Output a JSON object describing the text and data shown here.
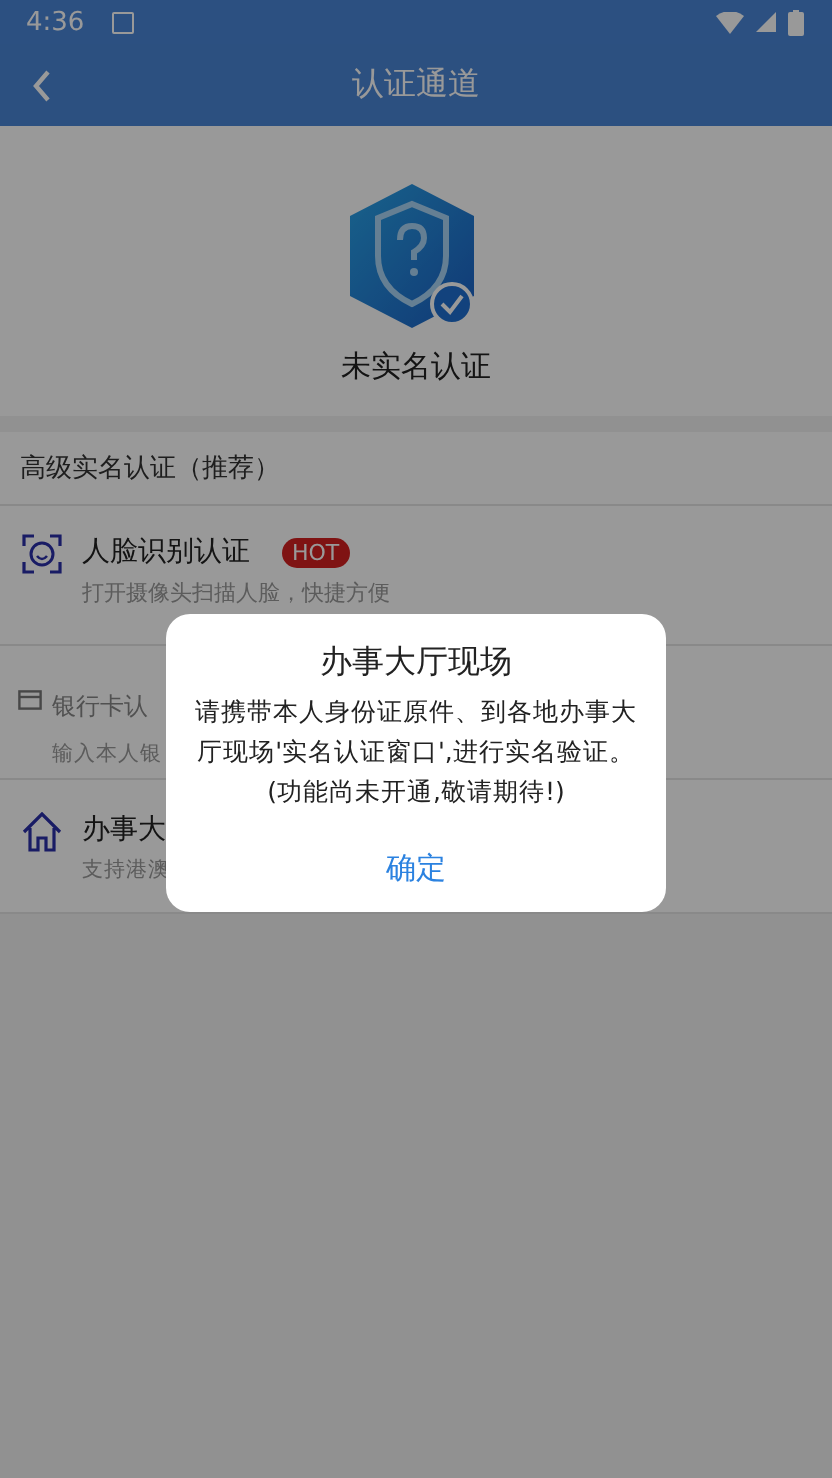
{
  "status_bar": {
    "time": "4:36"
  },
  "app_bar": {
    "title": "认证通道"
  },
  "profile": {
    "status": "未实名认证"
  },
  "section": {
    "title": "高级实名认证（推荐）"
  },
  "methods": [
    {
      "kind": "face",
      "title": "人脸识别认证",
      "badge": "HOT",
      "subtitle": "打开摄像头扫描人脸，快捷方便"
    },
    {
      "kind": "card",
      "title": "银行卡认",
      "subtitle": "输入本人银"
    },
    {
      "kind": "hall",
      "title": "办事大",
      "subtitle": "支持港澳"
    }
  ],
  "dialog": {
    "title": "办事大厅现场",
    "message": "请携带本人身份证原件、到各地办事大厅现场'实名认证窗口',进行实名验证。(功能尚未开通,敬请期待!)",
    "button": "确定"
  }
}
